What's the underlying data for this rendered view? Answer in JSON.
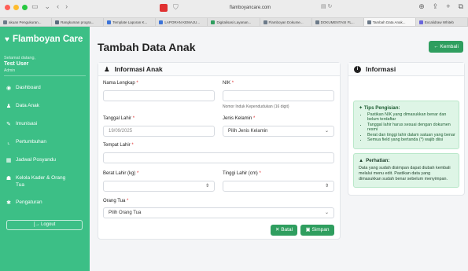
{
  "browser": {
    "url": "flamboyancare.com",
    "tabs": [
      {
        "label": "akuan Pengukuran...",
        "color": "#6c7a89"
      },
      {
        "label": "Rangkuman progra...",
        "color": "#5a6b7d"
      },
      {
        "label": "Template Laporan K...",
        "color": "#3b73d8"
      },
      {
        "label": "LAPORAN KEMAJU...",
        "color": "#3b73d8"
      },
      {
        "label": "Digitalisasi Layanan...",
        "color": "#2f9e5f"
      },
      {
        "label": "Flamboyan Dokume...",
        "color": "#6c7a89"
      },
      {
        "label": "DOKUMENTASI FL...",
        "color": "#6c7a89"
      },
      {
        "label": "Tambah Data Anak...",
        "color": "#6c7a89"
      },
      {
        "label": "Excalidraw Whiteb",
        "color": "#6965db"
      }
    ]
  },
  "sidebar": {
    "brand": "Flamboyan Care",
    "welcome": "Selamat datang,",
    "username": "Test User",
    "role": "Admin",
    "items": [
      {
        "label": "Dashboard",
        "icon": "gauge-icon",
        "glyph": "◉"
      },
      {
        "label": "Data Anak",
        "icon": "child-icon",
        "glyph": "♟"
      },
      {
        "label": "Imunisasi",
        "icon": "syringe-icon",
        "glyph": "✎"
      },
      {
        "label": "Pertumbuhan",
        "icon": "chart-icon",
        "glyph": "⌞"
      },
      {
        "label": "Jadwal Posyandu",
        "icon": "calendar-icon",
        "glyph": "▦"
      },
      {
        "label": "Kelola Kader & Orang Tua",
        "icon": "users-icon",
        "glyph": "☗"
      },
      {
        "label": "Pengaturan",
        "icon": "gear-icon",
        "glyph": "✱"
      }
    ],
    "logout": "Logout"
  },
  "main": {
    "title": "Tambah Data Anak",
    "back_label": "Kembali"
  },
  "form": {
    "header": "Informasi Anak",
    "nama_label": "Nama Lengkap",
    "nik_label": "NIK",
    "nik_help": "Nomor Induk Kependudukan (16 digit)",
    "tanggal_label": "Tanggal Lahir",
    "tanggal_value": "19/09/2025",
    "jenis_label": "Jenis Kelamin",
    "jenis_value": "Pilih Jenis Kelamin",
    "tempat_label": "Tempat Lahir",
    "berat_label": "Berat Lahir (kg)",
    "tinggi_label": "Tinggi Lahir (cm)",
    "ortu_label": "Orang Tua",
    "ortu_value": "Pilih Orang Tua",
    "batal": "Batal",
    "simpan": "Simpan"
  },
  "info": {
    "header": "Informasi",
    "tips_title": "Tips Pengisian:",
    "tips": [
      "Pastikan NIK yang dimasukkan benar dan belum terdaftar",
      "Tanggal lahir harus sesuai dengan dokumen resmi",
      "Berat dan tinggi lahir dalam satuan yang benar",
      "Semua field yang bertanda (*) wajib diisi"
    ],
    "warn_title": "Perhatian:",
    "warn_text": "Data yang sudah disimpan dapat diubah kembali melalui menu edit. Pastikan data yang dimasukkan sudah benar sebelum menyimpan."
  },
  "colors": {
    "sidebar": "#3cbf86",
    "primary_button": "#2f9e5f",
    "danger": "#e03131"
  }
}
